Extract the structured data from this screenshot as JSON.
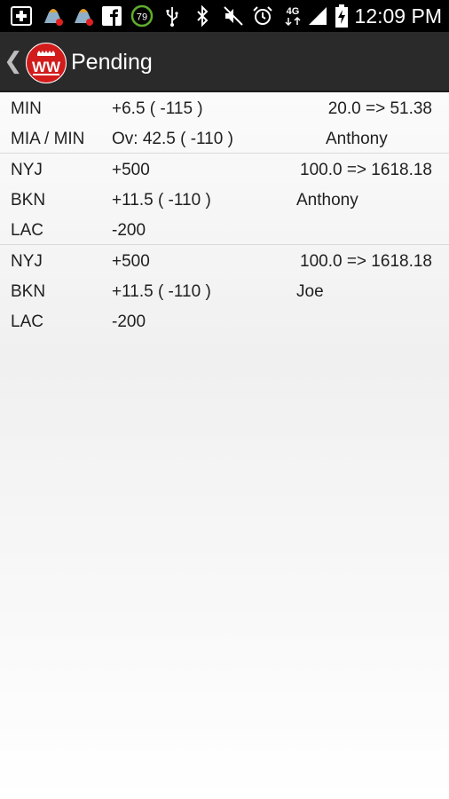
{
  "status_bar": {
    "time": "12:09 PM",
    "battery_level": "79",
    "network": "4G",
    "icons": [
      "notification-badge-icon",
      "app-notification-icon",
      "app-notification-icon",
      "facebook-icon",
      "battery-circle-icon",
      "usb-icon",
      "bluetooth-icon",
      "mute-icon",
      "alarm-icon",
      "network-4g-icon",
      "signal-icon",
      "battery-charging-icon"
    ]
  },
  "action_bar": {
    "title": "Pending",
    "back_icon": "back-chevron-icon",
    "logo": "ww-logo",
    "logo_text": "WW"
  },
  "bets": [
    {
      "rows": [
        {
          "team": "MIN",
          "line": "+6.5 ( -115 )",
          "right": "20.0 => 51.38"
        },
        {
          "team": "MIA / MIN",
          "line": "Ov: 42.5 ( -110 )",
          "right": "Anthony"
        }
      ]
    },
    {
      "rows": [
        {
          "team": "NYJ",
          "line": "+500",
          "right": "100.0 => 1618.18"
        },
        {
          "team": "BKN",
          "line": "+11.5 ( -110 )",
          "right": "Anthony"
        },
        {
          "team": "LAC",
          "line": "-200",
          "right": ""
        }
      ]
    },
    {
      "rows": [
        {
          "team": "NYJ",
          "line": "+500",
          "right": "100.0 => 1618.18"
        },
        {
          "team": "BKN",
          "line": "+11.5 ( -110 )",
          "right": "Joe"
        },
        {
          "team": "LAC",
          "line": "-200",
          "right": ""
        }
      ]
    }
  ],
  "colors": {
    "action_bar": "#2a2a2a",
    "logo_red": "#d21c1c",
    "text": "#1f1f1f",
    "divider": "#d9d9d9"
  }
}
